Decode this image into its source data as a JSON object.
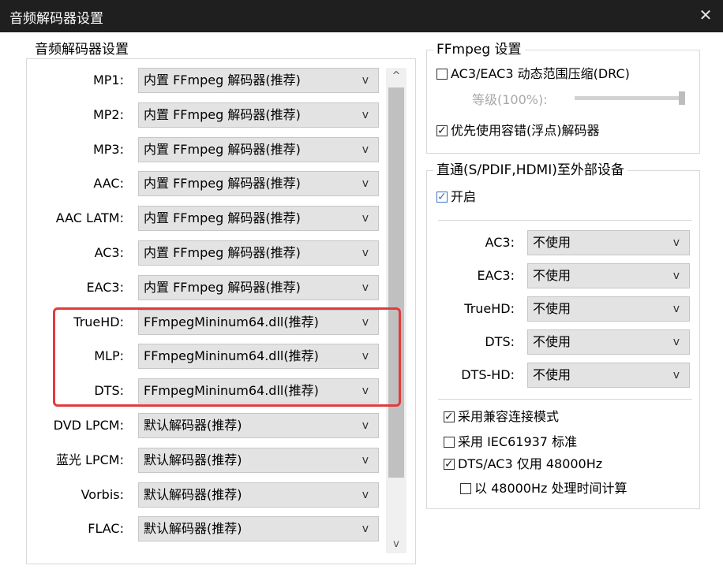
{
  "window": {
    "title": "音频解码器设置",
    "close_glyph": "✕"
  },
  "left_group": {
    "title": "音频解码器设置",
    "rows": [
      {
        "label": "MP1:",
        "value": "内置 FFmpeg 解码器(推荐)"
      },
      {
        "label": "MP2:",
        "value": "内置 FFmpeg 解码器(推荐)"
      },
      {
        "label": "MP3:",
        "value": "内置 FFmpeg 解码器(推荐)"
      },
      {
        "label": "AAC:",
        "value": "内置 FFmpeg 解码器(推荐)"
      },
      {
        "label": "AAC LATM:",
        "value": "内置 FFmpeg 解码器(推荐)"
      },
      {
        "label": "AC3:",
        "value": "内置 FFmpeg 解码器(推荐)"
      },
      {
        "label": "EAC3:",
        "value": "内置 FFmpeg 解码器(推荐)"
      },
      {
        "label": "TrueHD:",
        "value": "FFmpegMininum64.dll(推荐)"
      },
      {
        "label": "MLP:",
        "value": "FFmpegMininum64.dll(推荐)"
      },
      {
        "label": "DTS:",
        "value": "FFmpegMininum64.dll(推荐)"
      },
      {
        "label": "DVD LPCM:",
        "value": "默认解码器(推荐)"
      },
      {
        "label": "蓝光 LPCM:",
        "value": "默认解码器(推荐)"
      },
      {
        "label": "Vorbis:",
        "value": "默认解码器(推荐)"
      },
      {
        "label": "FLAC:",
        "value": "默认解码器(推荐)"
      }
    ],
    "arrow": "v",
    "scroll_up": "^",
    "scroll_down": "v"
  },
  "ffmpeg_group": {
    "title": "FFmpeg 设置",
    "drc_label": "AC3/EAC3 动态范围压缩(DRC)",
    "level_label": "等级(100%):",
    "level_value": 1.0,
    "prefer_label": "优先使用容错(浮点)解码器"
  },
  "passthrough_group": {
    "title": "直通(S/PDIF,HDMI)至外部设备",
    "enable_label": "开启",
    "rows": [
      {
        "label": "AC3:",
        "value": "不使用"
      },
      {
        "label": "EAC3:",
        "value": "不使用"
      },
      {
        "label": "TrueHD:",
        "value": "不使用"
      },
      {
        "label": "DTS:",
        "value": "不使用"
      },
      {
        "label": "DTS-HD:",
        "value": "不使用"
      }
    ],
    "options": {
      "compat_label": "采用兼容连接模式",
      "iec_label": "采用 IEC61937 标准",
      "dts48_label": "DTS/AC3 仅用 48000Hz",
      "time48_label": "以 48000Hz 处理时间计算"
    }
  },
  "colors": {
    "highlight": "#e23b3b",
    "titlebar": "#1f1f1f",
    "check_blue": "#3a73c4"
  }
}
